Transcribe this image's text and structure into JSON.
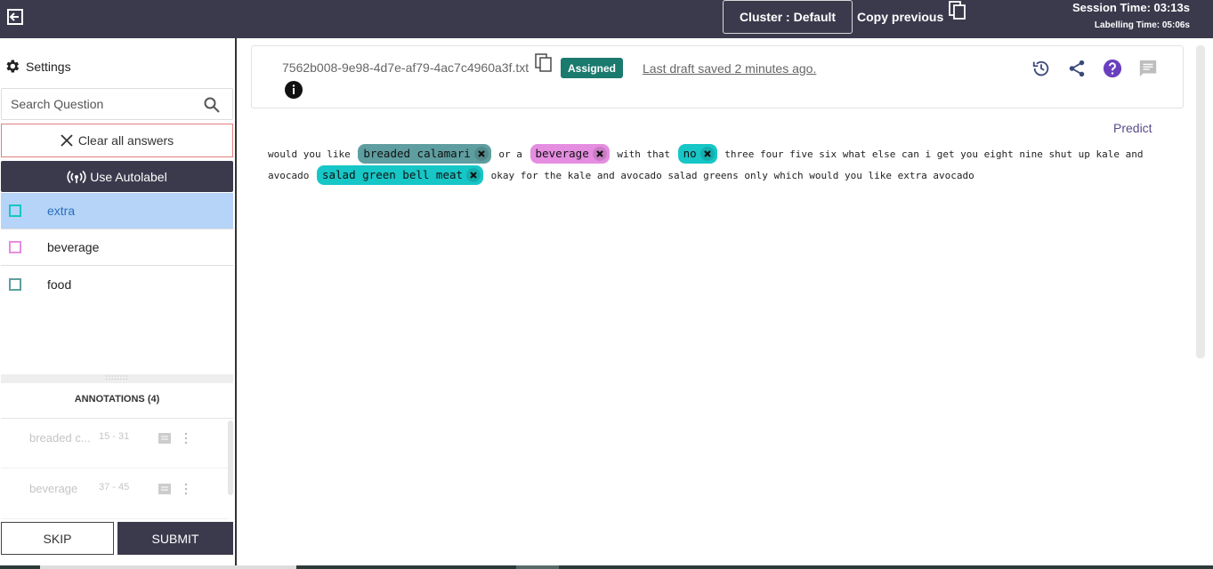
{
  "topbar": {
    "exit_icon": "exit-icon",
    "cluster_label": "Cluster : Default",
    "copy_previous_label": "Copy previous",
    "session_time": "Session Time: 03:13s",
    "labelling_time": "Labelling Time: 05:06s"
  },
  "sidebar": {
    "settings_label": "Settings",
    "search_placeholder": "Search Question",
    "clear_label": "Clear all answers",
    "autolabel_label": "Use Autolabel",
    "labels": [
      {
        "name": "extra",
        "color": "#17c6c6"
      },
      {
        "name": "beverage",
        "color": "#e58de0"
      },
      {
        "name": "food",
        "color": "#5f9ea0"
      }
    ],
    "annotations_title": "ANNOTATIONS (4)",
    "annotations": [
      {
        "text": "breaded c...",
        "range": "15 - 31"
      },
      {
        "text": "beverage",
        "range": "37 - 45"
      }
    ],
    "skip_label": "SKIP",
    "submit_label": "SUBMIT"
  },
  "document": {
    "filename": "7562b008-9e98-4d7e-af79-4ac7c4960a3f.txt",
    "status_badge": "Assigned",
    "draft_saved": "Last draft saved 2 minutes ago.",
    "predict_label": "Predict",
    "text": {
      "t1": "would you like",
      "s1": "breaded calamari",
      "t2": "or a",
      "s2": "beverage",
      "t3": "with that",
      "s3": "no",
      "t4": "three four five six what else can i get you eight nine shut up kale and avocado",
      "s4": "salad green bell meat",
      "t5": "okay for the kale and avocado salad greens only which would you like extra avocado"
    }
  }
}
